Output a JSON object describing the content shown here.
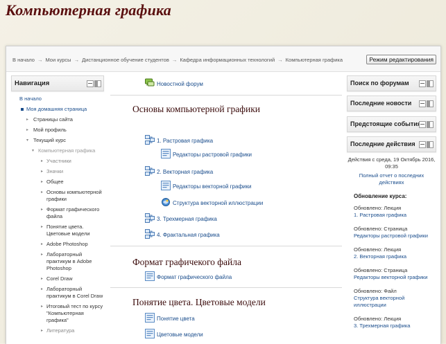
{
  "page_title": "Компьютерная графика",
  "breadcrumb": [
    "В начало",
    "Мои курсы",
    "Дистанционное обучение студентов",
    "Кафедра информационных технологий",
    "Компьютерная графика"
  ],
  "breadcrumb_separator": "→",
  "edit_button": "Режим редактирования",
  "nav": {
    "title": "Навигация",
    "items": [
      {
        "label": "В начало"
      },
      {
        "label": "Моя домашняя страница"
      },
      {
        "label": "Страницы сайта"
      },
      {
        "label": "Мой профиль"
      },
      {
        "label": "Текущий курс"
      },
      {
        "label": "Компьютерная графика"
      },
      {
        "label": "Участники"
      },
      {
        "label": "Значки"
      },
      {
        "label": "Общее"
      },
      {
        "label": "Основы компьютерной графики"
      },
      {
        "label": "Формат графического файла"
      },
      {
        "label": "Понятие цвета. Цветовые модели"
      },
      {
        "label": "Adobe Photoshop"
      },
      {
        "label": "Лабораторный практикум в Adobe Photoshop"
      },
      {
        "label": "Corel Draw"
      },
      {
        "label": "Лабораторный практикум в Corel Draw"
      },
      {
        "label": "Итоговый тест по курсу \"Компьютерная графика\""
      },
      {
        "label": "Литература"
      }
    ]
  },
  "center": {
    "forum": "Новостной форум",
    "sections": [
      {
        "title": "Основы компьютерной графики",
        "items": [
          "1. Растровая графика",
          "Редакторы растровой графики",
          "2. Векторная графика",
          "Редакторы векторной графики",
          "Структура векторной иллюстрации",
          "3. Трехмерная графика",
          "4. Фрактальная графика"
        ]
      },
      {
        "title": "Формат графичекого файла",
        "items": [
          "Формат графического файла"
        ]
      },
      {
        "title": "Понятие цвета. Цветовые модели",
        "items": [
          "Понятие цвета",
          "Цветовые модели"
        ]
      }
    ]
  },
  "right": {
    "blocks": [
      "Поиск по форумам",
      "Последние новости",
      "Предстоящие события",
      "Последние действия"
    ],
    "recent_since": "Действия с среда, 19 Октябрь 2016, 09:35",
    "full_report": "Полный отчет о последних действиях",
    "updates_heading": "Обновление курса:",
    "updates": [
      {
        "type": "Обновлено: Лекция",
        "name": "1. Растровая графика"
      },
      {
        "type": "Обновлено: Страница",
        "name": "Редакторы растровой графики"
      },
      {
        "type": "Обновлено: Лекция",
        "name": "2. Векторная графика"
      },
      {
        "type": "Обновлено: Страница",
        "name": "Редакторы векторной графики"
      },
      {
        "type": "Обновлено: Файл",
        "name": "Структура векторной иллюстрации"
      },
      {
        "type": "Обновлено: Лекция",
        "name": "3. Трехмерная графика"
      }
    ]
  },
  "colors": {
    "title": "#5a0f0f",
    "link": "#1a4d8c",
    "section_title": "#3a0a0a"
  },
  "icons": {
    "forum": "forum-icon",
    "lesson": "lesson-icon",
    "page": "page-icon",
    "file": "file-icon",
    "collapse": "collapse-icon",
    "dock": "dock-icon"
  }
}
